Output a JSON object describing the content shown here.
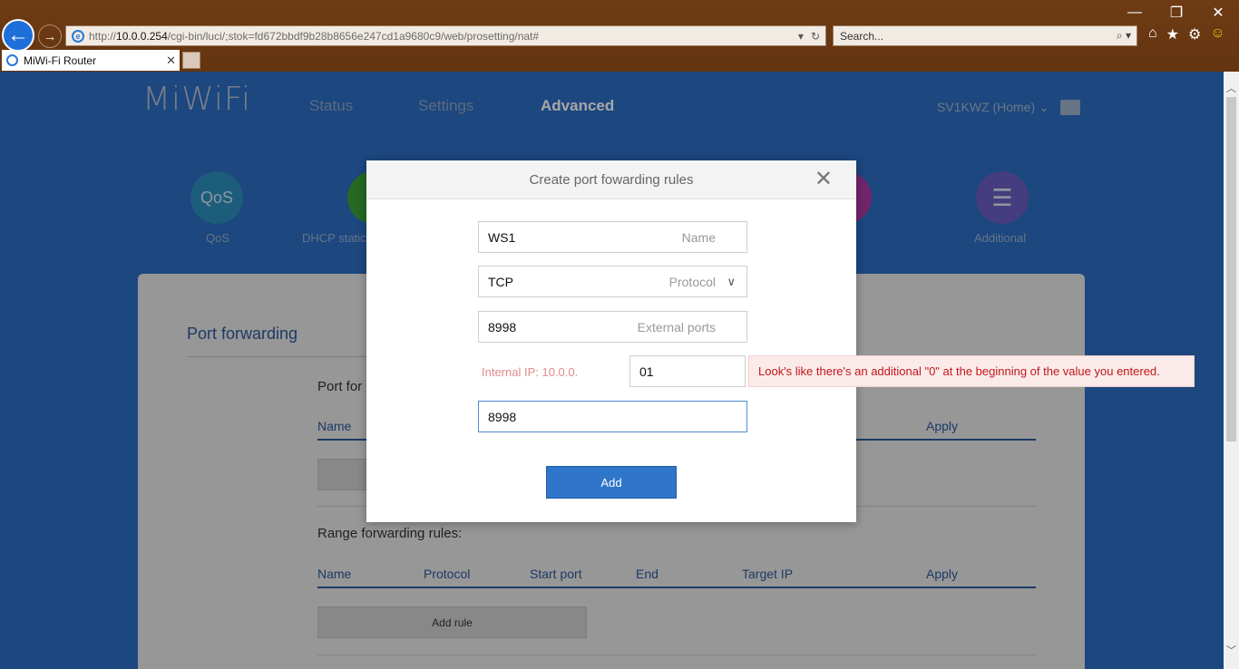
{
  "browser": {
    "url_prefix": "http://",
    "url_host": "10.0.0.254",
    "url_path": "/cgi-bin/luci/;stok=fd672bbdf9b28b8656e247cd1a9680c9/web/prosetting/nat#",
    "search_placeholder": "Search...",
    "tab_title": "MiWi-Fi Router"
  },
  "header": {
    "logo": "MiWiFi",
    "nav": [
      "Status",
      "Settings",
      "Advanced"
    ],
    "user": "SV1KWZ (Home) ⌄"
  },
  "shortcuts": [
    {
      "icon_text": "QoS",
      "label": "QoS",
      "color": "#2b8fbf"
    },
    {
      "icon_text": "",
      "label": "DHCP static",
      "color": "#3aa23a"
    },
    {
      "icon_text": "",
      "label": "",
      "color": "#b03aa6"
    },
    {
      "icon_text": "☰",
      "label": "Additional",
      "color": "#6b5fc4"
    }
  ],
  "panel": {
    "title": "Port forwarding",
    "port_subtitle": "Port for",
    "port_headers": {
      "name": "Name",
      "apply": "Apply"
    },
    "range_title": "Range forwarding rules:",
    "range_headers": {
      "name": "Name",
      "protocol": "Protocol",
      "start": "Start port",
      "end": "End",
      "target": "Target IP",
      "apply": "Apply"
    },
    "add_rule": "Add rule"
  },
  "modal": {
    "title": "Create port fowarding rules",
    "name_value": "WS1",
    "name_hint": "Name",
    "protocol_value": "TCP",
    "protocol_hint": "Protocol",
    "external_value": "8998",
    "external_hint": "External ports",
    "internal_ip_label": "Internal IP: 10.0.0.",
    "internal_ip_value": "01",
    "internal_port_value": "8998",
    "add_button": "Add"
  },
  "tooltip": {
    "message": "Look's like there's an additional \"0\" at the beginning of the value you entered."
  }
}
